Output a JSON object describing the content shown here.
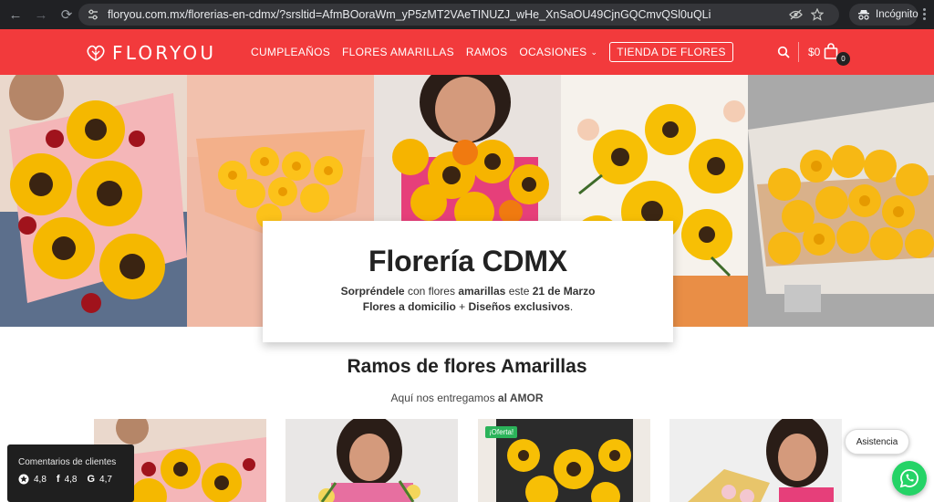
{
  "browser": {
    "url": "floryou.com.mx/florerias-en-cdmx/?srsltid=AfmBOoraWm_yP5zMT2VAeTINUZJ_wHe_XnSaOU49CjnGQCmvQSl0uQLi",
    "incognito_label": "Incógnito"
  },
  "header": {
    "logo_text": "FLORYOU",
    "menu": [
      "CUMPLEAÑOS",
      "FLORES AMARILLAS",
      "RAMOS",
      "OCASIONES"
    ],
    "shop_button": "TIENDA DE FLORES",
    "cart_total": "$0",
    "cart_count": "0"
  },
  "hero": {
    "title": "Florería CDMX",
    "line1": {
      "p1": "Sorpréndele",
      "p2": " con flores ",
      "p3": "amarillas",
      "p4": " este ",
      "p5": "21 de Marzo"
    },
    "line2": {
      "p1": "Flores a domicilio",
      "p2": " + ",
      "p3": "Diseños exclusivos",
      "p4": "."
    }
  },
  "section": {
    "title": "Ramos de flores Amarillas",
    "subtitle_a": "Aquí nos entregamos ",
    "subtitle_b": "al AMOR"
  },
  "products": {
    "oferta_label": "¡Oferta!"
  },
  "reviews": {
    "title": "Comentarios de clientes",
    "ratings": [
      {
        "source": "star-icon",
        "value": "4,8"
      },
      {
        "source": "facebook-icon",
        "value": "4,8"
      },
      {
        "source": "google-icon",
        "value": "4,7"
      }
    ]
  },
  "widgets": {
    "assist_label": "Asistencia"
  },
  "colors": {
    "brand_red": "#f23a3c",
    "whatsapp_green": "#25d366",
    "oferta_green": "#2bb35a"
  }
}
